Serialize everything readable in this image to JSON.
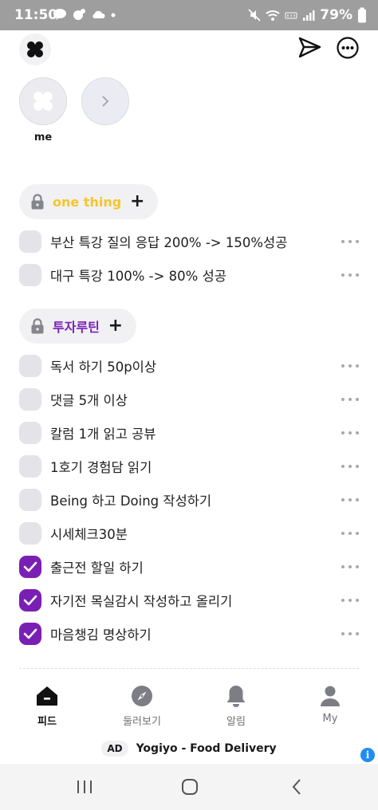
{
  "status_bar": {
    "time": "11:50",
    "battery": "79%",
    "left_icons": [
      "talk-icon",
      "chat-icon",
      "cloud-icon",
      "dot-icon"
    ],
    "right_icons": [
      "mute-icon",
      "wifi-icon",
      "lte-icon",
      "signal-icon",
      "battery-icon"
    ]
  },
  "header": {
    "icons": [
      "logo-icon",
      "send-icon",
      "more-icon"
    ]
  },
  "stories": {
    "me_label": "me"
  },
  "colors": {
    "category_one_thing": "#f5c52b",
    "category_invest": "#7a1fb4",
    "check_done": "#7a1fb4",
    "check_empty": "#e4e4e8",
    "ad_info": "#1f8ef0"
  },
  "categories": [
    {
      "label": "one thing",
      "add_label": "+",
      "todos": [
        {
          "text": "부산 특강 질의 응답 200% -> 150%성공",
          "done": false
        },
        {
          "text": "대구 특강 100% -> 80% 성공",
          "done": false
        }
      ]
    },
    {
      "label": "투자루틴",
      "add_label": "+",
      "todos": [
        {
          "text": "독서 하기 50p이상",
          "done": false
        },
        {
          "text": "댓글 5개 이상",
          "done": false
        },
        {
          "text": "칼럼 1개 읽고 공뷰",
          "done": false
        },
        {
          "text": "1호기 경험담 읽기",
          "done": false
        },
        {
          "text": "Being 하고 Doing 작성하기",
          "done": false
        },
        {
          "text": "시세체크30분",
          "done": false
        },
        {
          "text": "출근전 할일 하기",
          "done": true
        },
        {
          "text": "자기전 목실감시 작성하고 올리기",
          "done": true
        },
        {
          "text": "마음챙김 명상하기",
          "done": true
        }
      ]
    }
  ],
  "tabs": [
    {
      "label": "피드",
      "icon": "home-icon",
      "active": true
    },
    {
      "label": "둘러보기",
      "icon": "compass-icon",
      "active": false
    },
    {
      "label": "알림",
      "icon": "bell-icon",
      "active": false
    },
    {
      "label": "My",
      "icon": "person-icon",
      "active": false
    }
  ],
  "ad": {
    "badge": "AD",
    "text": "Yogiyo - Food Delivery",
    "info": "i"
  }
}
